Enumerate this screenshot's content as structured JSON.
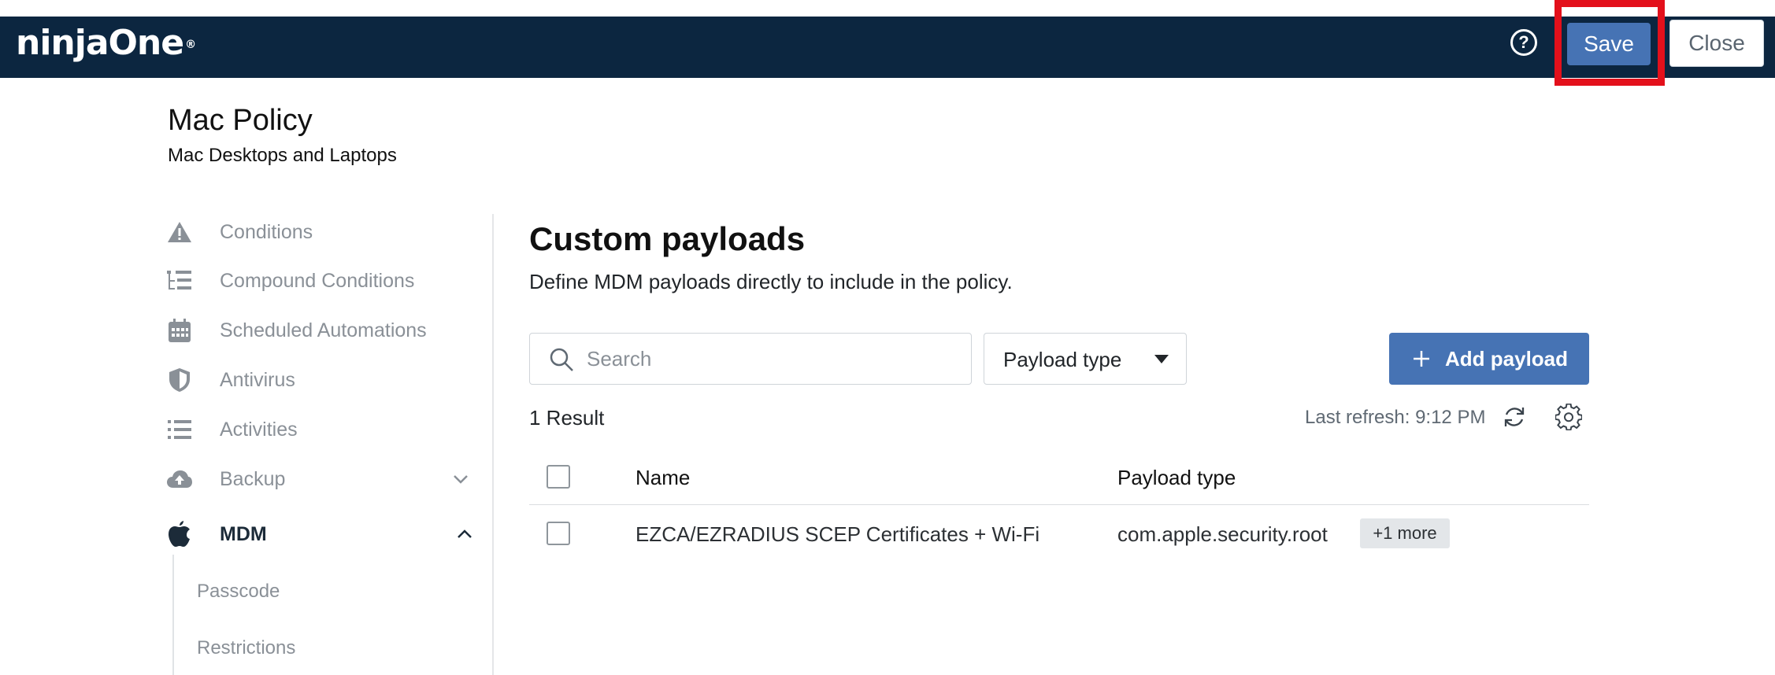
{
  "header": {
    "logo_text": "ninjaOne",
    "logo_mark": "®",
    "help_icon": "question-circle-icon",
    "save_label": "Save",
    "close_label": "Close",
    "highlight_color": "#e3101b",
    "bg_color": "#0c2640"
  },
  "policy": {
    "title": "Mac Policy",
    "subtitle": "Mac Desktops and Laptops"
  },
  "sidebar": {
    "items": [
      {
        "label": "Conditions",
        "icon": "warning-icon"
      },
      {
        "label": "Compound Conditions",
        "icon": "tree-list-icon"
      },
      {
        "label": "Scheduled Automations",
        "icon": "calendar-icon"
      },
      {
        "label": "Antivirus",
        "icon": "shield-icon"
      },
      {
        "label": "Activities",
        "icon": "list-icon"
      },
      {
        "label": "Backup",
        "icon": "cloud-upload-icon",
        "expanded": false
      },
      {
        "label": "MDM",
        "icon": "apple-icon",
        "expanded": true,
        "active": true
      }
    ],
    "sub_items": [
      {
        "label": "Passcode"
      },
      {
        "label": "Restrictions"
      }
    ]
  },
  "main": {
    "title": "Custom payloads",
    "description": "Define MDM payloads directly to include in the policy.",
    "search_placeholder": "Search",
    "payload_type_filter": "Payload type",
    "add_button": "Add payload",
    "result_count": "1 Result",
    "last_refresh": "Last refresh: 9:12 PM",
    "accent_color": "#4673b4"
  },
  "table": {
    "columns": [
      "Name",
      "Payload type"
    ],
    "rows": [
      {
        "name": "EZCA/EZRADIUS SCEP Certificates + Wi-Fi",
        "payload_type": "com.apple.security.root",
        "more": "+1 more"
      }
    ]
  }
}
